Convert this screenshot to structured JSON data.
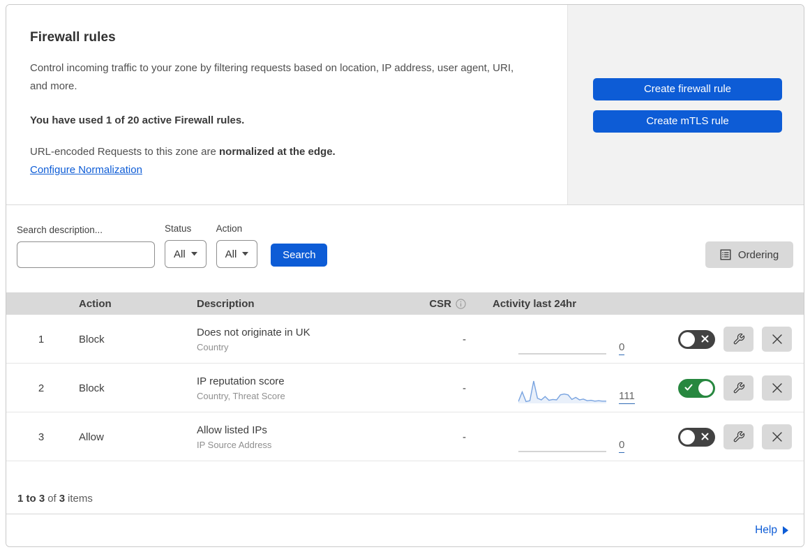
{
  "colors": {
    "accent_blue": "#0d5cd6",
    "toggle_on_green": "#27873f",
    "toggle_off_gray": "#424242",
    "table_header_band": "#d9d9d9",
    "side_panel_gray": "#f2f2f2",
    "gray_button": "#d9d9d9",
    "sparkline_stroke": "#78a3e0",
    "sparkline_fill": "rgba(120,163,224,0.16)",
    "flat_line_gray": "#a8a8a8"
  },
  "header": {
    "title": "Firewall rules",
    "description": "Control incoming traffic to your zone by filtering requests based on location, IP address, user agent, URI, and more.",
    "usage_text": "You have used 1 of 20 active Firewall rules.",
    "normalization_prefix": "URL-encoded Requests to this zone are ",
    "normalization_bold": "normalized at the edge.",
    "normalization_link_label": "Configure Normalization",
    "create_firewall_rule_label": "Create firewall rule",
    "create_mtls_rule_label": "Create mTLS rule"
  },
  "filters": {
    "search_label": "Search description...",
    "search_value": "",
    "status_label": "Status",
    "status_value": "All",
    "action_label": "Action",
    "action_value": "All",
    "search_button_label": "Search",
    "ordering_button_label": "Ordering"
  },
  "table": {
    "columns": {
      "action": "Action",
      "description": "Description",
      "csr": "CSR",
      "activity": "Activity last 24hr"
    },
    "rows": [
      {
        "priority": "1",
        "action": "Block",
        "description": "Does not originate in UK",
        "rule_fields": "Country",
        "csr": "-",
        "activity_count": "0",
        "enabled": false,
        "activity_series": [
          0,
          0,
          0,
          0,
          0,
          0,
          0,
          0,
          0,
          0,
          0,
          0,
          0,
          0,
          0,
          0,
          0,
          0,
          0,
          0,
          0,
          0,
          0,
          0
        ]
      },
      {
        "priority": "2",
        "action": "Block",
        "description": "IP reputation score",
        "rule_fields": "Country, Threat Score",
        "csr": "-",
        "activity_count": "111",
        "enabled": true,
        "activity_series": [
          2,
          48,
          2,
          6,
          100,
          18,
          10,
          26,
          8,
          12,
          10,
          34,
          38,
          34,
          12,
          22,
          10,
          14,
          6,
          8,
          4,
          6,
          4,
          4
        ]
      },
      {
        "priority": "3",
        "action": "Allow",
        "description": "Allow listed IPs",
        "rule_fields": "IP Source Address",
        "csr": "-",
        "activity_count": "0",
        "enabled": false,
        "activity_series": [
          0,
          0,
          0,
          0,
          0,
          0,
          0,
          0,
          0,
          0,
          0,
          0,
          0,
          0,
          0,
          0,
          0,
          0,
          0,
          0,
          0,
          0,
          0,
          0
        ]
      }
    ]
  },
  "footer": {
    "range_bold": "1 to 3",
    "of_text": "of",
    "total_bold": "3",
    "items_text": "items",
    "help_label": "Help"
  }
}
